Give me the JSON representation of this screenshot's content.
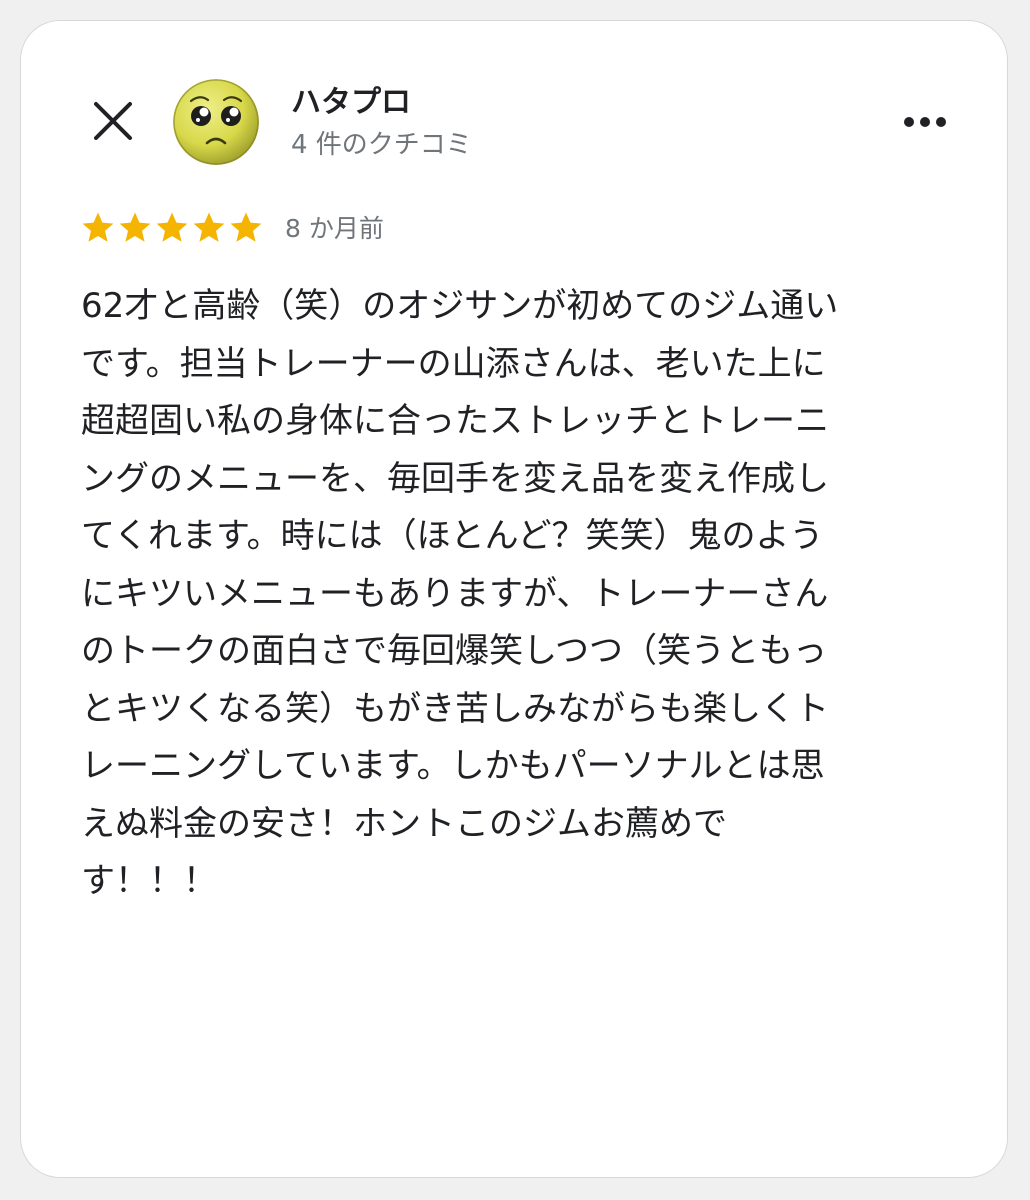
{
  "header": {
    "close_icon": "close-icon",
    "avatar_icon": "pleading-face-avatar",
    "user_name": "ハタプロ",
    "review_count": "4 件のクチコミ",
    "more_icon": "more-horizontal-icon"
  },
  "rating": {
    "stars": 5,
    "max_stars": 5,
    "star_color": "#f4b400",
    "time_ago": "8 か月前"
  },
  "review": {
    "lines": [
      "62才と高齢（笑）のオジサンが初めてのジム通い",
      "です。担当トレーナーの山添さんは、老いた上に",
      "超超固い私の身体に合ったストレッチとトレーニ",
      "ングのメニューを、毎回手を変え品を変え作成し",
      "てくれます。時には（ほとんど？笑笑）鬼のよう",
      "にキツいメニューもありますが、トレーナーさん",
      "のトークの面白さで毎回爆笑しつつ（笑うともっ",
      "とキツくなる笑）もがき苦しみながらも楽しくト",
      "レーニングしています。しかもパーソナルとは思",
      "えぬ料金の安さ！ホントこのジムお薦めで",
      "す！！！"
    ]
  }
}
